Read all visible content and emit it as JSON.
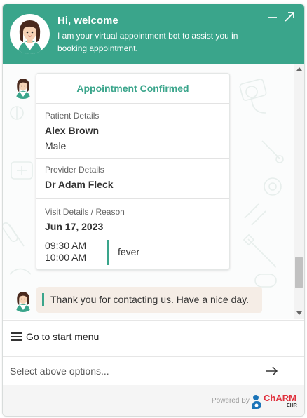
{
  "header": {
    "title": "Hi, welcome",
    "subtitle": "I am your virtual appointment bot to assist you in booking appointment.",
    "accent_color": "#3aa58b",
    "icons": [
      "bot-avatar-icon",
      "minimize-icon",
      "expand-icon"
    ]
  },
  "appointment": {
    "title": "Appointment Confirmed",
    "patient": {
      "label": "Patient Details",
      "name": "Alex Brown",
      "gender": "Male"
    },
    "provider": {
      "label": "Provider Details",
      "name": "Dr Adam Fleck"
    },
    "visit": {
      "label": "Visit Details / Reason",
      "date": "Jun 17, 2023",
      "start_time": "09:30 AM",
      "end_time": "10:00 AM",
      "reason": "fever"
    }
  },
  "message": {
    "text": "Thank you for contacting us. Have a nice day."
  },
  "menu": {
    "label": "Go to start menu"
  },
  "input": {
    "placeholder": "Select above options...",
    "value": ""
  },
  "footer": {
    "powered_by": "Powered By",
    "brand": "ChARM",
    "brand_sub": "EHR"
  },
  "colors": {
    "message_bg": "#f5ede6",
    "brand_red": "#e0323e"
  }
}
